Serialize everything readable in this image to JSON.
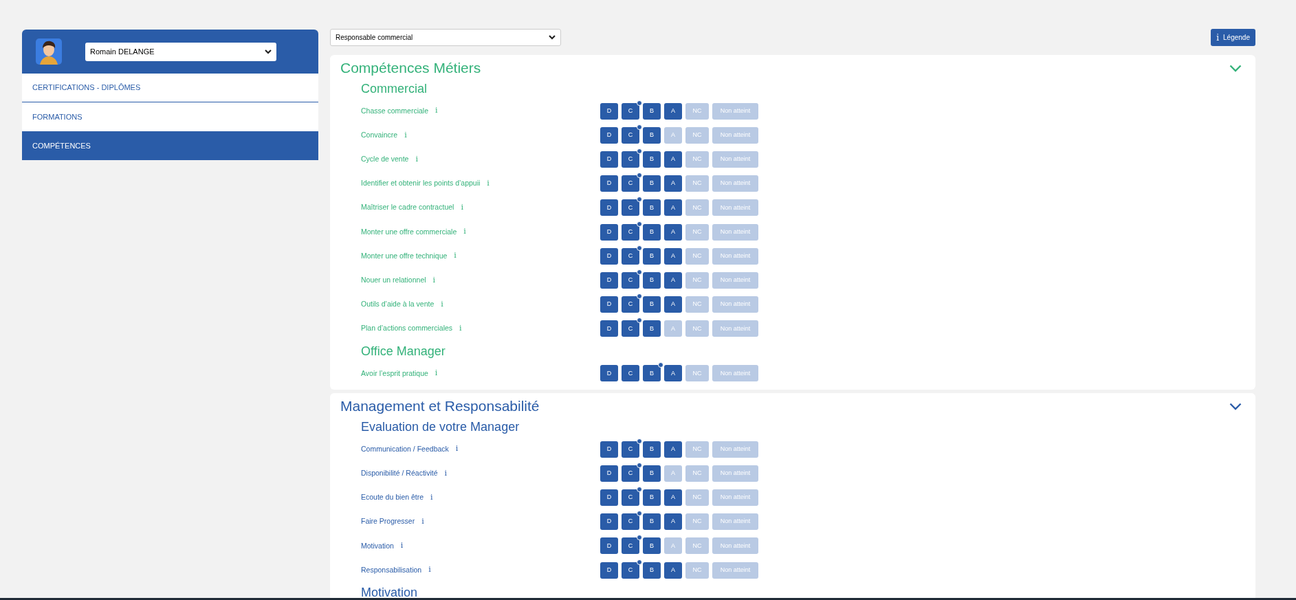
{
  "sidebar": {
    "user_select": {
      "value": "Romain DELANGE"
    },
    "items": [
      {
        "label": "CERTIFICATIONS - DIPLÔMES",
        "selected": false
      },
      {
        "label": "FORMATIONS",
        "selected": false
      },
      {
        "label": "COMPÉTENCES",
        "selected": true
      }
    ]
  },
  "job_select": {
    "value": "Responsable commercial"
  },
  "legend_button": {
    "icon": "i",
    "label": "Légende"
  },
  "sections": [
    {
      "title": "Compétences Métiers",
      "color": "#34b27a",
      "groups": [
        {
          "title": "Commercial",
          "rows": [
            {
              "label": "Chasse commerciale",
              "info": "i",
              "buttons": [
                {
                  "label": "D",
                  "on": true,
                  "marked": false
                },
                {
                  "label": "C",
                  "on": true,
                  "marked": true
                },
                {
                  "label": "B",
                  "on": true,
                  "marked": false
                },
                {
                  "label": "A",
                  "on": true,
                  "marked": false
                },
                {
                  "label": "NC",
                  "on": false,
                  "marked": false
                },
                {
                  "label": "Non atteint",
                  "on": false,
                  "marked": false
                }
              ]
            },
            {
              "label": "Convaincre",
              "info": "i",
              "buttons": [
                {
                  "label": "D",
                  "on": true,
                  "marked": false
                },
                {
                  "label": "C",
                  "on": true,
                  "marked": true
                },
                {
                  "label": "B",
                  "on": true,
                  "marked": false
                },
                {
                  "label": "A",
                  "on": false,
                  "marked": false
                },
                {
                  "label": "NC",
                  "on": false,
                  "marked": false
                },
                {
                  "label": "Non atteint",
                  "on": false,
                  "marked": false
                }
              ]
            },
            {
              "label": "Cycle de vente",
              "info": "i",
              "buttons": [
                {
                  "label": "D",
                  "on": true,
                  "marked": false
                },
                {
                  "label": "C",
                  "on": true,
                  "marked": true
                },
                {
                  "label": "B",
                  "on": true,
                  "marked": false
                },
                {
                  "label": "A",
                  "on": true,
                  "marked": false
                },
                {
                  "label": "NC",
                  "on": false,
                  "marked": false
                },
                {
                  "label": "Non atteint",
                  "on": false,
                  "marked": false
                }
              ]
            },
            {
              "label": "Identifier et obtenir les points d’appuii",
              "info": "i",
              "buttons": [
                {
                  "label": "D",
                  "on": true,
                  "marked": false
                },
                {
                  "label": "C",
                  "on": true,
                  "marked": true
                },
                {
                  "label": "B",
                  "on": true,
                  "marked": false
                },
                {
                  "label": "A",
                  "on": true,
                  "marked": false
                },
                {
                  "label": "NC",
                  "on": false,
                  "marked": false
                },
                {
                  "label": "Non atteint",
                  "on": false,
                  "marked": false
                }
              ]
            },
            {
              "label": "Maîtriser le cadre contractuel",
              "info": "i",
              "buttons": [
                {
                  "label": "D",
                  "on": true,
                  "marked": false
                },
                {
                  "label": "C",
                  "on": true,
                  "marked": true
                },
                {
                  "label": "B",
                  "on": true,
                  "marked": false
                },
                {
                  "label": "A",
                  "on": true,
                  "marked": false
                },
                {
                  "label": "NC",
                  "on": false,
                  "marked": false
                },
                {
                  "label": "Non atteint",
                  "on": false,
                  "marked": false
                }
              ]
            },
            {
              "label": "Monter une offre commerciale",
              "info": "i",
              "buttons": [
                {
                  "label": "D",
                  "on": true,
                  "marked": false
                },
                {
                  "label": "C",
                  "on": true,
                  "marked": true
                },
                {
                  "label": "B",
                  "on": true,
                  "marked": false
                },
                {
                  "label": "A",
                  "on": true,
                  "marked": false
                },
                {
                  "label": "NC",
                  "on": false,
                  "marked": false
                },
                {
                  "label": "Non atteint",
                  "on": false,
                  "marked": false
                }
              ]
            },
            {
              "label": "Monter une offre technique",
              "info": "i",
              "buttons": [
                {
                  "label": "D",
                  "on": true,
                  "marked": false
                },
                {
                  "label": "C",
                  "on": true,
                  "marked": true
                },
                {
                  "label": "B",
                  "on": true,
                  "marked": false
                },
                {
                  "label": "A",
                  "on": true,
                  "marked": false
                },
                {
                  "label": "NC",
                  "on": false,
                  "marked": false
                },
                {
                  "label": "Non atteint",
                  "on": false,
                  "marked": false
                }
              ]
            },
            {
              "label": "Nouer un relationnel",
              "info": "i",
              "buttons": [
                {
                  "label": "D",
                  "on": true,
                  "marked": false
                },
                {
                  "label": "C",
                  "on": true,
                  "marked": true
                },
                {
                  "label": "B",
                  "on": true,
                  "marked": false
                },
                {
                  "label": "A",
                  "on": true,
                  "marked": false
                },
                {
                  "label": "NC",
                  "on": false,
                  "marked": false
                },
                {
                  "label": "Non atteint",
                  "on": false,
                  "marked": false
                }
              ]
            },
            {
              "label": "Outils d’aide à la vente",
              "info": "i",
              "buttons": [
                {
                  "label": "D",
                  "on": true,
                  "marked": false
                },
                {
                  "label": "C",
                  "on": true,
                  "marked": true
                },
                {
                  "label": "B",
                  "on": true,
                  "marked": false
                },
                {
                  "label": "A",
                  "on": true,
                  "marked": false
                },
                {
                  "label": "NC",
                  "on": false,
                  "marked": false
                },
                {
                  "label": "Non atteint",
                  "on": false,
                  "marked": false
                }
              ]
            },
            {
              "label": "Plan d’actions commerciales",
              "info": "i",
              "buttons": [
                {
                  "label": "D",
                  "on": true,
                  "marked": false
                },
                {
                  "label": "C",
                  "on": true,
                  "marked": true
                },
                {
                  "label": "B",
                  "on": true,
                  "marked": false
                },
                {
                  "label": "A",
                  "on": false,
                  "marked": false
                },
                {
                  "label": "NC",
                  "on": false,
                  "marked": false
                },
                {
                  "label": "Non atteint",
                  "on": false,
                  "marked": false
                }
              ]
            }
          ]
        },
        {
          "title": "Office Manager",
          "rows": [
            {
              "label": "Avoir l’esprit pratique",
              "info": "i",
              "buttons": [
                {
                  "label": "D",
                  "on": true,
                  "marked": false
                },
                {
                  "label": "C",
                  "on": true,
                  "marked": false
                },
                {
                  "label": "B",
                  "on": true,
                  "marked": true
                },
                {
                  "label": "A",
                  "on": true,
                  "marked": false
                },
                {
                  "label": "NC",
                  "on": false,
                  "marked": false
                },
                {
                  "label": "Non atteint",
                  "on": false,
                  "marked": false
                }
              ]
            }
          ]
        }
      ]
    },
    {
      "title": "Management et Responsabilité",
      "color": "#2a5ca8",
      "groups": [
        {
          "title": "Evaluation de votre Manager",
          "rows": [
            {
              "label": "Communication / Feedback",
              "info": "i",
              "buttons": [
                {
                  "label": "D",
                  "on": true,
                  "marked": false
                },
                {
                  "label": "C",
                  "on": true,
                  "marked": true
                },
                {
                  "label": "B",
                  "on": true,
                  "marked": false
                },
                {
                  "label": "A",
                  "on": true,
                  "marked": false
                },
                {
                  "label": "NC",
                  "on": false,
                  "marked": false
                },
                {
                  "label": "Non atteint",
                  "on": false,
                  "marked": false
                }
              ]
            },
            {
              "label": "Disponibilité / Réactivité",
              "info": "i",
              "buttons": [
                {
                  "label": "D",
                  "on": true,
                  "marked": false
                },
                {
                  "label": "C",
                  "on": true,
                  "marked": true
                },
                {
                  "label": "B",
                  "on": true,
                  "marked": false
                },
                {
                  "label": "A",
                  "on": false,
                  "marked": false
                },
                {
                  "label": "NC",
                  "on": false,
                  "marked": false
                },
                {
                  "label": "Non atteint",
                  "on": false,
                  "marked": false
                }
              ]
            },
            {
              "label": "Ecoute du bien être",
              "info": "i",
              "buttons": [
                {
                  "label": "D",
                  "on": true,
                  "marked": false
                },
                {
                  "label": "C",
                  "on": true,
                  "marked": true
                },
                {
                  "label": "B",
                  "on": true,
                  "marked": false
                },
                {
                  "label": "A",
                  "on": true,
                  "marked": false
                },
                {
                  "label": "NC",
                  "on": false,
                  "marked": false
                },
                {
                  "label": "Non atteint",
                  "on": false,
                  "marked": false
                }
              ]
            },
            {
              "label": "Faire Progresser",
              "info": "i",
              "buttons": [
                {
                  "label": "D",
                  "on": true,
                  "marked": false
                },
                {
                  "label": "C",
                  "on": true,
                  "marked": true
                },
                {
                  "label": "B",
                  "on": true,
                  "marked": false
                },
                {
                  "label": "A",
                  "on": true,
                  "marked": false
                },
                {
                  "label": "NC",
                  "on": false,
                  "marked": false
                },
                {
                  "label": "Non atteint",
                  "on": false,
                  "marked": false
                }
              ]
            },
            {
              "label": "Motivation",
              "info": "i",
              "buttons": [
                {
                  "label": "D",
                  "on": true,
                  "marked": false
                },
                {
                  "label": "C",
                  "on": true,
                  "marked": true
                },
                {
                  "label": "B",
                  "on": true,
                  "marked": false
                },
                {
                  "label": "A",
                  "on": false,
                  "marked": false
                },
                {
                  "label": "NC",
                  "on": false,
                  "marked": false
                },
                {
                  "label": "Non atteint",
                  "on": false,
                  "marked": false
                }
              ]
            },
            {
              "label": "Responsabilisation",
              "info": "i",
              "buttons": [
                {
                  "label": "D",
                  "on": true,
                  "marked": false
                },
                {
                  "label": "C",
                  "on": true,
                  "marked": true
                },
                {
                  "label": "B",
                  "on": true,
                  "marked": false
                },
                {
                  "label": "A",
                  "on": true,
                  "marked": false
                },
                {
                  "label": "NC",
                  "on": false,
                  "marked": false
                },
                {
                  "label": "Non atteint",
                  "on": false,
                  "marked": false
                }
              ]
            }
          ]
        },
        {
          "title": "Motivation"
        }
      ]
    }
  ]
}
